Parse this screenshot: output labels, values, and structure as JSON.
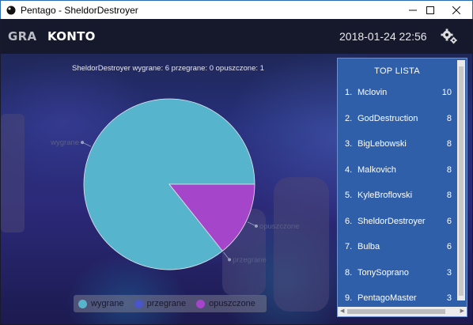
{
  "window": {
    "title": "Pentago - SheldorDestroyer"
  },
  "nav": {
    "tabs": [
      {
        "label": "GRA"
      },
      {
        "label": "KONTO"
      }
    ]
  },
  "header": {
    "datetime": "2018-01-24 22:56",
    "settings_icon": "gear-icon"
  },
  "chart": {
    "title": "SheldorDestroyer wygrane: 6 przegrane: 0 opuszczone: 1"
  },
  "chart_data": {
    "type": "pie",
    "title": "SheldorDestroyer wygrane: 6 przegrane: 0 opuszczone: 1",
    "categories": [
      "wygrane",
      "przegrane",
      "opuszczone"
    ],
    "values": [
      6,
      0,
      1
    ],
    "colors": [
      "#56b4cc",
      "#4a55c9",
      "#a545c9"
    ],
    "legend_position": "bottom-left"
  },
  "toplist": {
    "header": "TOP LISTA",
    "rows": [
      {
        "rank": "1.",
        "name": "Mclovin",
        "score": "10"
      },
      {
        "rank": "2.",
        "name": "GodDestruction",
        "score": "8"
      },
      {
        "rank": "3.",
        "name": "BigLebowski",
        "score": "8"
      },
      {
        "rank": "4.",
        "name": "Malkovich",
        "score": "8"
      },
      {
        "rank": "5.",
        "name": "KyleBroflovski",
        "score": "8"
      },
      {
        "rank": "6.",
        "name": "SheldorDestroyer",
        "score": "6"
      },
      {
        "rank": "7.",
        "name": "Bulba",
        "score": "6"
      },
      {
        "rank": "8.",
        "name": "TonySoprano",
        "score": "3"
      },
      {
        "rank": "9.",
        "name": "PentagoMaster",
        "score": "3"
      }
    ]
  }
}
